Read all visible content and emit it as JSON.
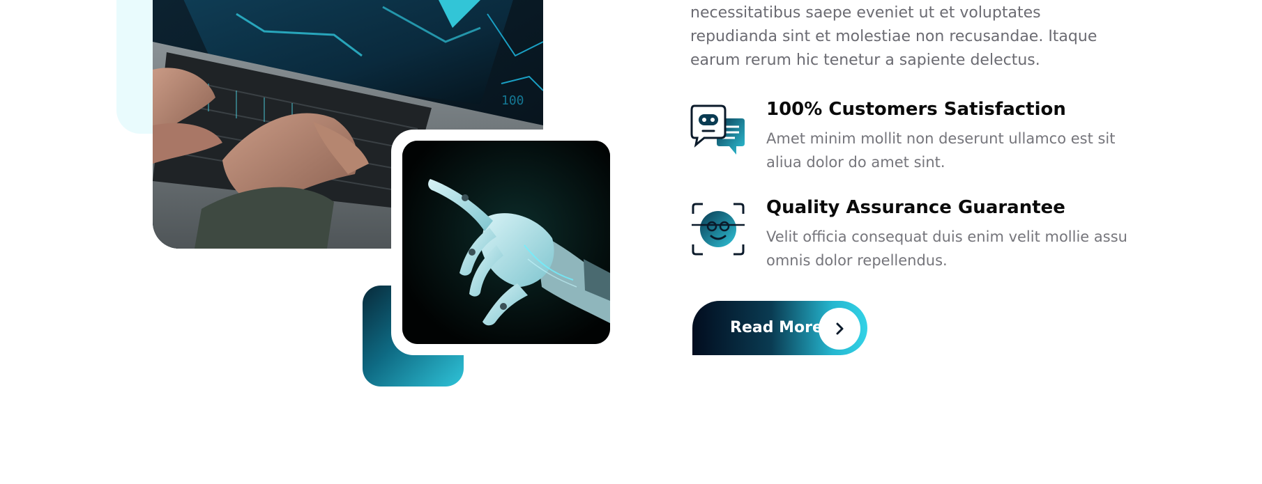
{
  "about": {
    "intro": "necessitatibus saepe eveniet ut et voluptates repudianda sint et molestiae non recusandae. Itaque earum rerum hic tenetur a sapiente delectus.",
    "features": [
      {
        "icon": "chatbot-icon",
        "title": "100% Customers Satisfaction",
        "description": "Amet minim mollit non deserunt ullamco est sit aliua dolor do amet sint."
      },
      {
        "icon": "face-recognition-icon",
        "title": "Quality Assurance Guarantee",
        "description": "Velit officia consequat duis enim velit mollie assu omnis dolor repellendus."
      }
    ],
    "cta": {
      "label": "Read More",
      "icon": "chevron-right-icon"
    }
  },
  "images": {
    "laptop": "laptop-typing-photo",
    "robot": "robot-hand-photo"
  },
  "colors": {
    "accent_dark": "#020d1f",
    "accent_teal": "#0e6a83",
    "accent_cyan": "#33d2e6",
    "mint_bg": "#e9fbfd",
    "heading": "#0a0a0a",
    "body_text": "#6b6b72"
  }
}
